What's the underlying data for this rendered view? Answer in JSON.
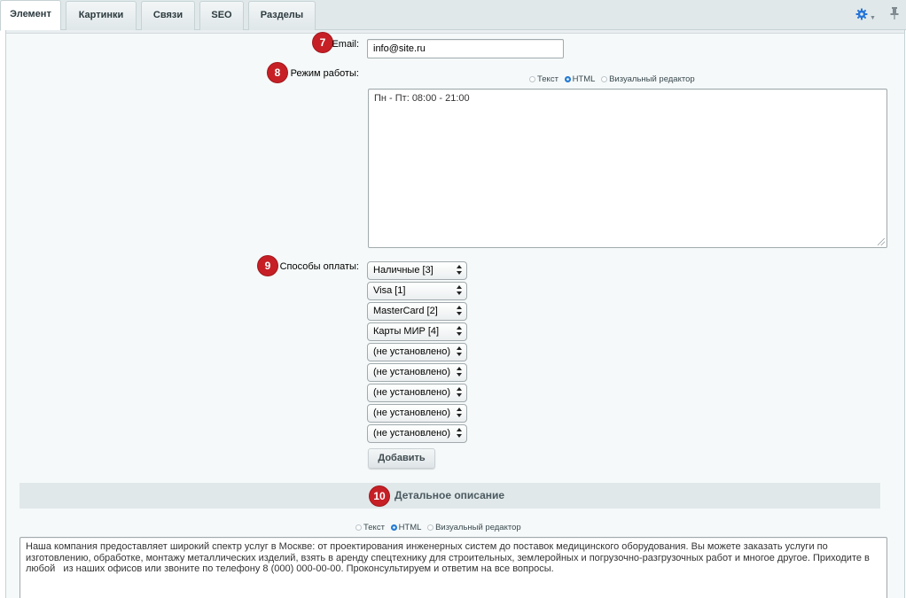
{
  "tabs": [
    {
      "label": "Элемент",
      "active": true
    },
    {
      "label": "Картинки",
      "active": false
    },
    {
      "label": "Связи",
      "active": false
    },
    {
      "label": "SEO",
      "active": false
    },
    {
      "label": "Разделы",
      "active": false
    }
  ],
  "toolbar": {
    "settings_icon": "gear-icon",
    "pin_icon": "pin-icon",
    "accent_color": "#2675d7"
  },
  "badges": {
    "email": "7",
    "hours": "8",
    "payment": "9",
    "description": "10",
    "color": "#c62026"
  },
  "email": {
    "label": "Email:",
    "value": "info@site.ru"
  },
  "hours": {
    "label": "Режим работы:",
    "modes": [
      "Текст",
      "HTML",
      "Визуальный редактор"
    ],
    "selected_mode": "HTML",
    "value": "Пн - Пт: 08:00 - 21:00"
  },
  "payment": {
    "label": "Способы оплаты:",
    "selects": [
      "Наличные [3]",
      "Visa [1]",
      "MasterCard [2]",
      "Карты МИР [4]",
      "(не установлено)",
      "(не установлено)",
      "(не установлено)",
      "(не установлено)",
      "(не установлено)"
    ],
    "add_label": "Добавить"
  },
  "description": {
    "title": "Детальное описание",
    "modes": [
      "Текст",
      "HTML",
      "Визуальный редактор"
    ],
    "selected_mode": "HTML",
    "value": "Наша компания предоставляет широкий спектр услуг в Москве: от проектирования инженерных систем до поставок медицинского оборудования. Вы можете заказать услуги по изготовлению, обработке, монтажу металлических изделий, взять в аренду спецтехнику для строительных, землеройных и погрузочно-разгрузочных работ и многое другое. Приходите в любой   из наших офисов или звоните по телефону 8 (000) 000-00-00. Проконсультируем и ответим на все вопросы."
  }
}
